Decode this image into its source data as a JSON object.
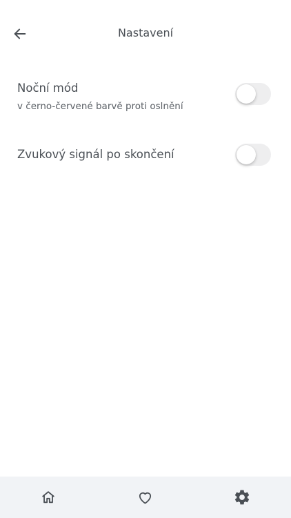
{
  "header": {
    "title": "Nastavení",
    "back_icon": "arrow-left-icon"
  },
  "settings": {
    "items": [
      {
        "label": "Noční mód",
        "sublabel": "v černo-červené barvě proti oslnění",
        "enabled": false
      },
      {
        "label": "Zvukový signál po skončení",
        "enabled": false
      }
    ]
  },
  "bottom_nav": {
    "items": [
      {
        "icon": "home-icon"
      },
      {
        "icon": "heart-icon"
      },
      {
        "icon": "gear-icon",
        "active": true
      }
    ]
  },
  "colors": {
    "text": "#4a4f55",
    "nav_background": "#f1f3f6",
    "toggle_track": "#eeeeef",
    "icon": "#4a4f55"
  }
}
